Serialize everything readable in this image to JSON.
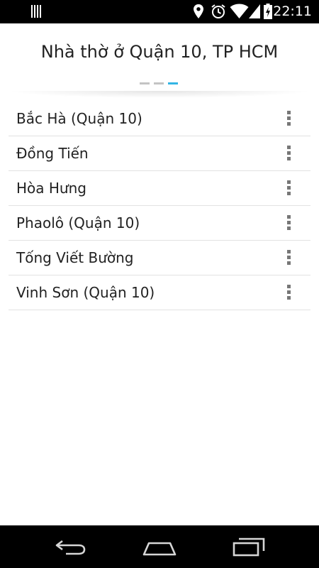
{
  "status_bar": {
    "time": "22:11",
    "icons": [
      "notification-icon",
      "location-icon",
      "alarm-icon",
      "wifi-icon",
      "signal-icon",
      "battery-charging-icon"
    ]
  },
  "header": {
    "title": "Nhà thờ ở Quận 10, TP HCM",
    "pager": {
      "count": 3,
      "active_index": 2,
      "active_color": "#33b5e5",
      "inactive_color": "#c4c4c4"
    }
  },
  "list": {
    "items": [
      {
        "label": "Bắc Hà (Quận 10)"
      },
      {
        "label": "Đồng Tiến"
      },
      {
        "label": "Hòa Hưng"
      },
      {
        "label": "Phaolô (Quận 10)"
      },
      {
        "label": "Tống Viết Bường"
      },
      {
        "label": "Vinh Sơn (Quận 10)"
      }
    ],
    "item_menu_icon": "overflow-menu-icon"
  },
  "nav_bar": {
    "buttons": [
      "back-icon",
      "home-icon",
      "recent-apps-icon"
    ]
  }
}
